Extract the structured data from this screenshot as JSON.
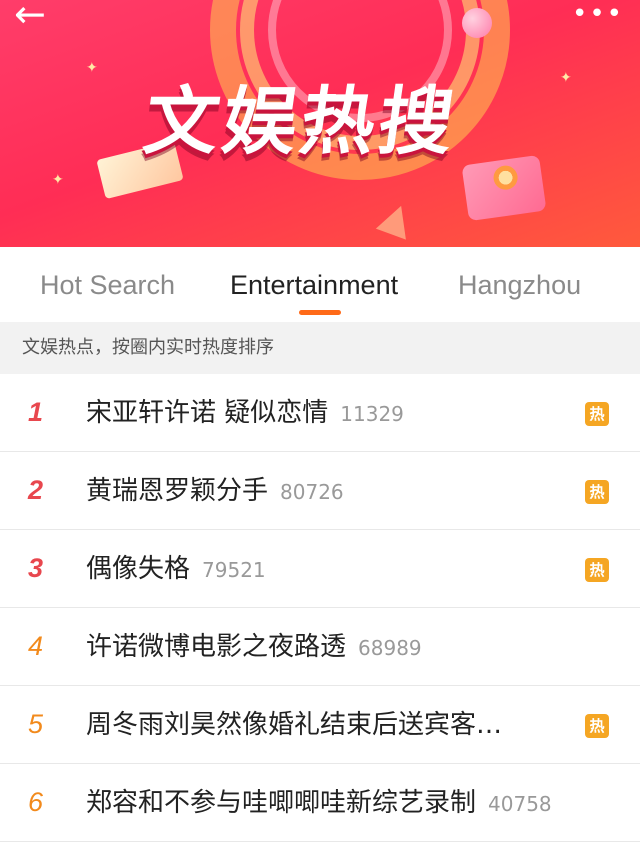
{
  "header": {
    "title": "文娱热搜",
    "back_icon": "arrow-left-icon",
    "more_icon": "more-dots-icon",
    "back_glyph": "←",
    "more_glyph": "•••"
  },
  "tabs": [
    {
      "label": "Hot Search",
      "active": false
    },
    {
      "label": "Entertainment",
      "active": true
    },
    {
      "label": "Hangzhou",
      "active": false
    }
  ],
  "colors": {
    "accent": "#ff6a18",
    "rank_top": "#e8474e",
    "rank_rest": "#f28a1c",
    "hot_badge": "#f5a623"
  },
  "subheader": "文娱热点，按圈内实时热度排序",
  "hot_badge_label": "热",
  "items": [
    {
      "rank": "1",
      "title": "宋亚轩许诺 疑似恋情",
      "count": "11329",
      "hot": true
    },
    {
      "rank": "2",
      "title": "黄瑞恩罗颖分手",
      "count": "80726",
      "hot": true
    },
    {
      "rank": "3",
      "title": "偶像失格",
      "count": "79521",
      "hot": true
    },
    {
      "rank": "4",
      "title": "许诺微博电影之夜路透",
      "count": "68989",
      "hot": false
    },
    {
      "rank": "5",
      "title": "周冬雨刘昊然像婚礼结束后送宾客…",
      "count": "",
      "hot": true
    },
    {
      "rank": "6",
      "title": "郑容和不参与哇唧唧哇新综艺录制",
      "count": "40758",
      "hot": false
    }
  ]
}
